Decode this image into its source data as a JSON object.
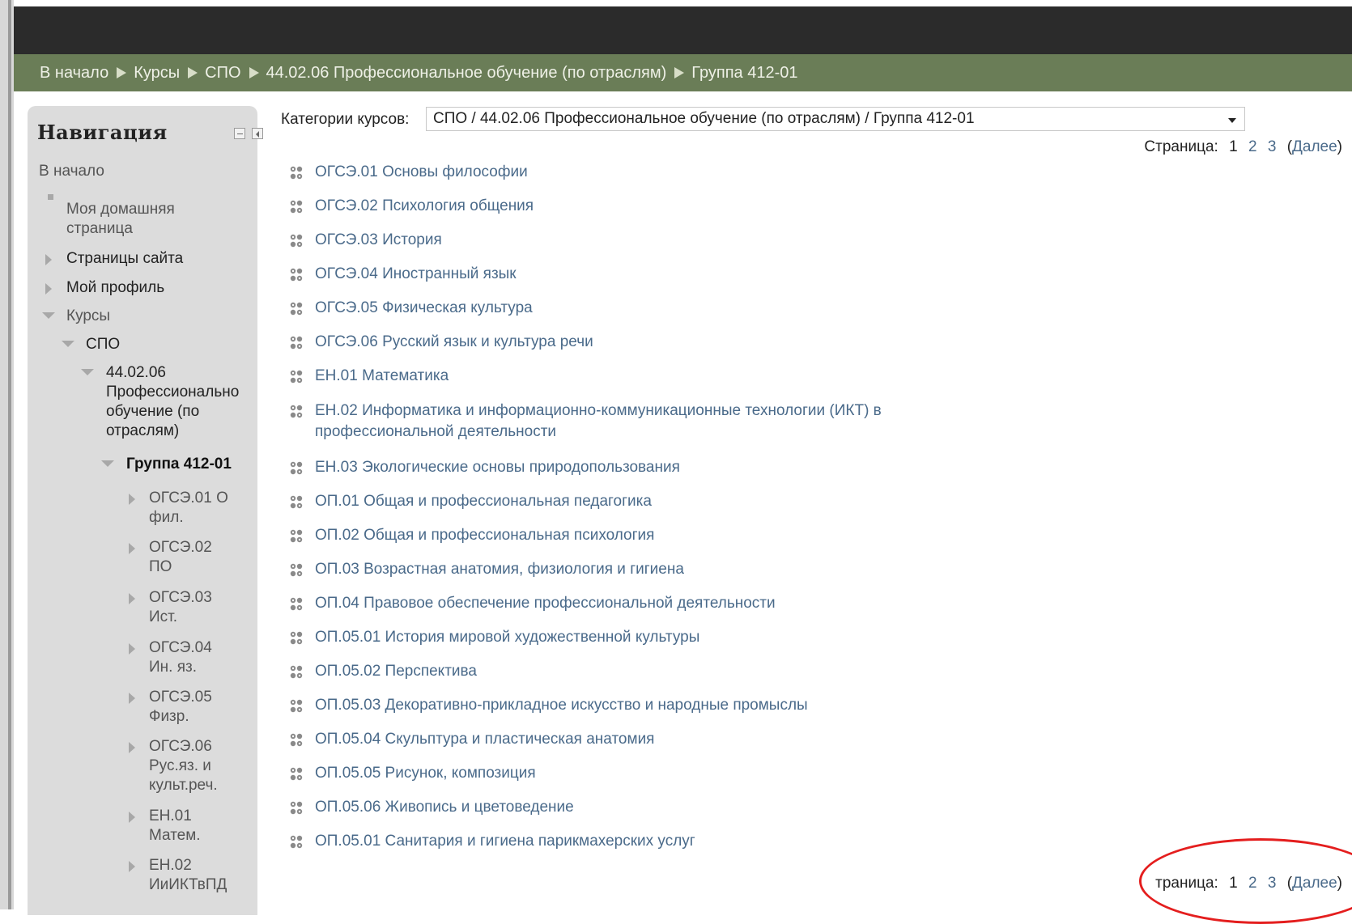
{
  "breadcrumb": [
    "В начало",
    "Курсы",
    "СПО",
    "44.02.06 Профессиональное обучение (по отраслям)",
    "Группа 412-01"
  ],
  "navigation": {
    "title": "Навигация",
    "home": "В начало",
    "my_home_line1": "Моя домашняя",
    "my_home_line2": "страница",
    "site_pages": "Страницы сайта",
    "my_profile": "Мой профиль",
    "courses": "Курсы",
    "spo": "СПО",
    "prog_line1": "44.02.06",
    "prog_line2": "Профессионально",
    "prog_line3": "обучение (по",
    "prog_line4": "отраслям)",
    "group": "Группа 412-01",
    "sub": [
      {
        "l1": "ОГСЭ.01 О",
        "l2": "фил."
      },
      {
        "l1": "ОГСЭ.02",
        "l2": "ПО"
      },
      {
        "l1": "ОГСЭ.03",
        "l2": "Ист."
      },
      {
        "l1": "ОГСЭ.04",
        "l2": "Ин. яз."
      },
      {
        "l1": "ОГСЭ.05",
        "l2": "Физр."
      },
      {
        "l1": "ОГСЭ.06",
        "l2": "Рус.яз. и",
        "l3": "культ.реч."
      },
      {
        "l1": "ЕН.01",
        "l2": "Матем."
      },
      {
        "l1": "ЕН.02",
        "l2": "ИиИКТвПД"
      }
    ]
  },
  "category": {
    "label": "Категории курсов:",
    "value": "СПО / 44.02.06 Профессиональное обучение (по отраслям) / Группа 412-01"
  },
  "pager": {
    "label": "Страница:",
    "label_bottom": "траница:",
    "current": "1",
    "p2": "2",
    "p3": "3",
    "next": "Далее"
  },
  "courses": [
    "ОГСЭ.01 Основы философии",
    "ОГСЭ.02 Психология общения",
    "ОГСЭ.03 История",
    "ОГСЭ.04 Иностранный язык",
    "ОГСЭ.05 Физическая культура",
    "ОГСЭ.06 Русский язык и культура речи",
    "ЕН.01 Математика",
    "ЕН.02 Информатика и информационно-коммуникационные технологии (ИКТ) в",
    "профессиональной деятельности",
    "ЕН.03 Экологические основы природопользования",
    "ОП.01 Общая и профессиональная педагогика",
    "ОП.02 Общая и профессиональная психология",
    "ОП.03 Возрастная анатомия, физиология и гигиена",
    "ОП.04 Правовое обеспечение профессиональной деятельности",
    "ОП.05.01 История мировой художественной культуры",
    "ОП.05.02 Перспектива",
    "ОП.05.03 Декоративно-прикладное искусство и народные промыслы",
    "ОП.05.04 Скульптура и пластическая анатомия",
    "ОП.05.05 Рисунок, композиция",
    "ОП.05.06 Живопись и цветоведение",
    "ОП.05.01 Санитария и гигиена парикмахерских услуг"
  ],
  "colors": {
    "navbar": "#6a7d57",
    "link": "#4a6a8a",
    "annotation": "#e41e1e"
  }
}
